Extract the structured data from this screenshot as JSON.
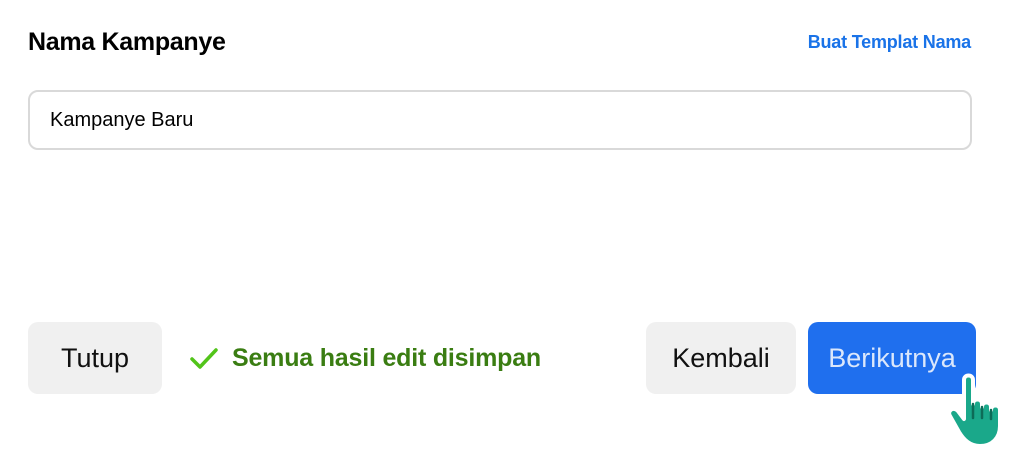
{
  "header": {
    "title": "Nama Kampanye",
    "template_link": "Buat Templat Nama"
  },
  "campaign_name": {
    "value": "Kampanye Baru"
  },
  "footer": {
    "close_label": "Tutup",
    "save_status": "Semua hasil edit disimpan",
    "back_label": "Kembali",
    "next_label": "Berikutnya"
  },
  "icons": {
    "status": "check-icon",
    "pointer": "hand-pointer-cursor-icon"
  },
  "colors": {
    "link": "#1a73e8",
    "primary": "#1f6fee",
    "success": "#3a7d12",
    "check": "#52c41a",
    "cursor": "#1aa88a"
  }
}
